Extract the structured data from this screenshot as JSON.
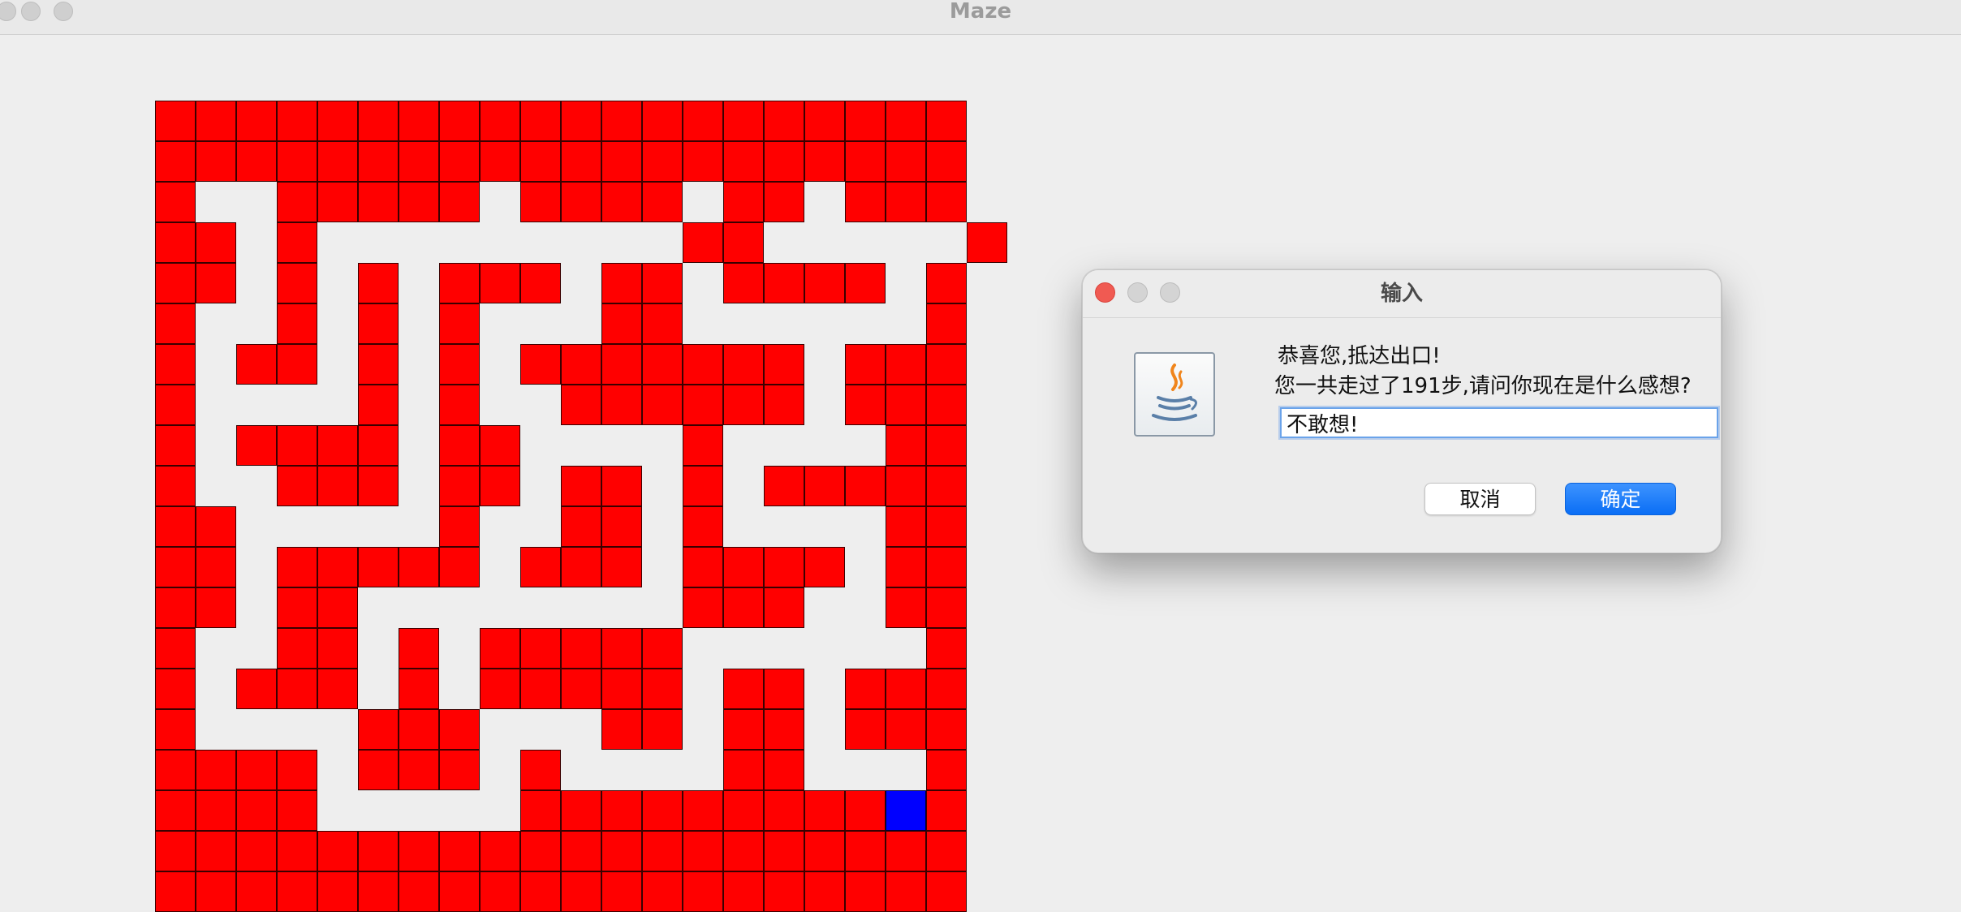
{
  "window": {
    "title": "Maze"
  },
  "maze": {
    "rows": [
      "####################",
      "####################",
      "#..#####.####.##.###",
      "##.#.........##.....#",
      "##.#.#.###.##.####.#",
      "#..#.#.#...##......#",
      "#.##.#.#.#######.###",
      "#....#.#..######.###",
      "#.####.##....#....##",
      "#..###.##.##.#.#####",
      "##.....#..##.#....##",
      "##.#####.###.####.##",
      "##.##........###..##",
      "#..##.#.#####......#",
      "#.###.#.#####.##.###",
      "#....###...##.##.###",
      "####.###.#....##...#",
      "####.....#########P#",
      "####################",
      "####################"
    ],
    "colors": {
      "wall": "#ff0000",
      "player": "#0000ff",
      "floor": "#eeeeee"
    }
  },
  "dialog": {
    "title": "输入",
    "message_line1": "恭喜您,抵达出口!",
    "message_line2": "您一共走过了191步,请问你现在是什么感想?",
    "input_value": "不敢想!",
    "cancel_label": "取消",
    "ok_label": "确定",
    "icon": "java-icon",
    "accent_color": "#0a6ef5"
  }
}
